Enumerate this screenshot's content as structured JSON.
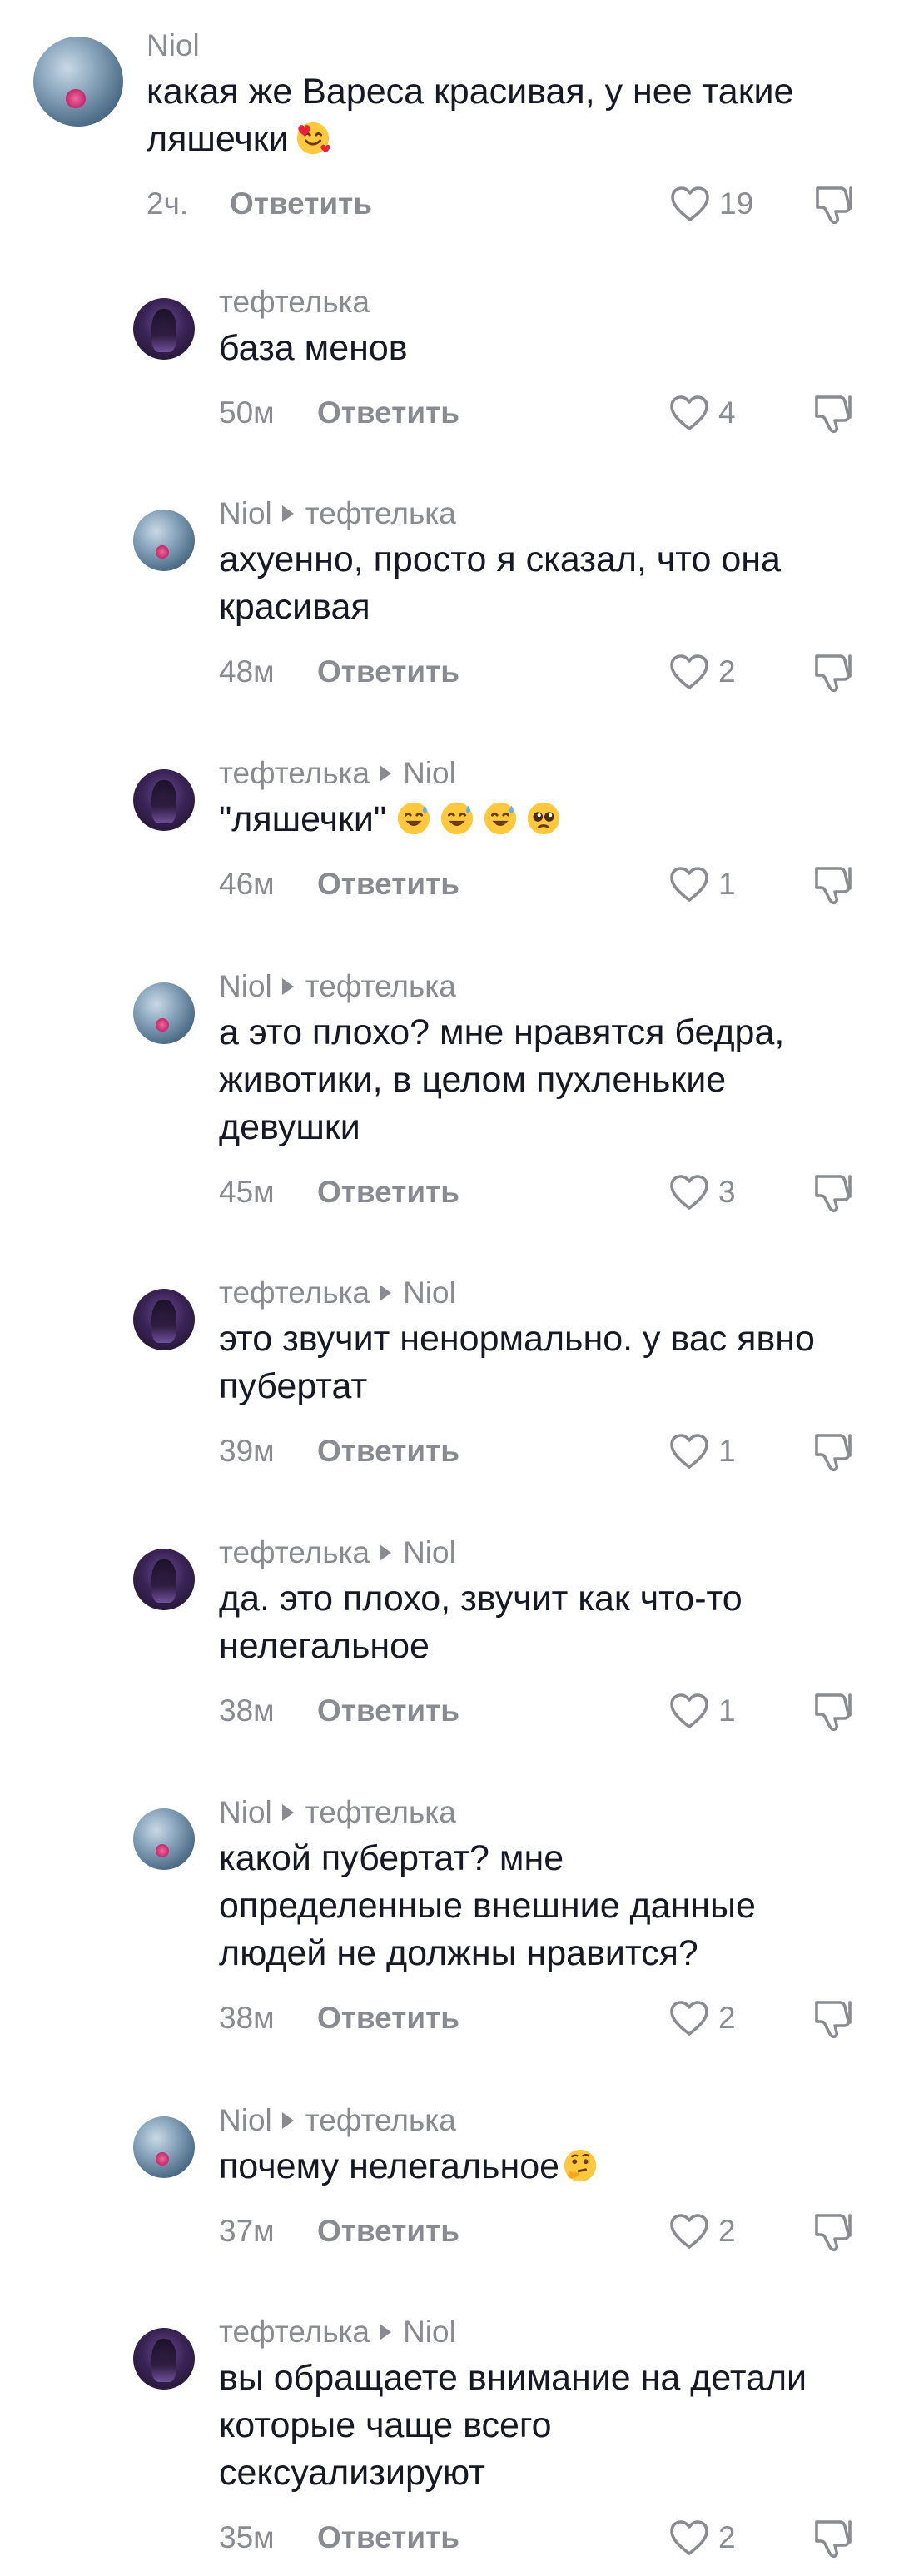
{
  "icons": {
    "like": "heart-outline-icon",
    "dislike": "thumbs-down-icon",
    "reply_arrow": "triangle-right-icon"
  },
  "colors": {
    "text": "#161823",
    "secondary": "#8a8b91",
    "background": "#ffffff"
  },
  "comments": [
    {
      "author": "Niol",
      "reply_to": "",
      "text": "какая же Вареса красивая, у нее такие",
      "text2": "ляшечки",
      "emoji": "🥰",
      "time": "2ч.",
      "reply_label": "Ответить",
      "likes": "19"
    },
    {
      "author": "тефтелька",
      "reply_to": "",
      "text": "база менов",
      "time": "50м",
      "reply_label": "Ответить",
      "likes": "4"
    },
    {
      "author": "Niol",
      "reply_to": "тефтелька",
      "text": "ахуенно, просто я сказал, что она\nкрасивая",
      "time": "48м",
      "reply_label": "Ответить",
      "likes": "2"
    },
    {
      "author": "тефтелька",
      "reply_to": "Niol",
      "text": "\"ляшечки\"",
      "emoji": "😅😅😅🥺",
      "time": "46м",
      "reply_label": "Ответить",
      "likes": "1"
    },
    {
      "author": "Niol",
      "reply_to": "тефтелька",
      "text": "а это плохо? мне нравятся бедра,\nживотики, в целом пухленькие\nдевушки",
      "time": "45м",
      "reply_label": "Ответить",
      "likes": "3"
    },
    {
      "author": "тефтелька",
      "reply_to": "Niol",
      "text": "это звучит ненормально. у вас явно\nпубертат",
      "time": "39м",
      "reply_label": "Ответить",
      "likes": "1"
    },
    {
      "author": "тефтелька",
      "reply_to": "Niol",
      "text": "да. это плохо, звучит как что-то\nнелегальное",
      "time": "38м",
      "reply_label": "Ответить",
      "likes": "1"
    },
    {
      "author": "Niol",
      "reply_to": "тефтелька",
      "text": "какой пубертат? мне\nопределенные внешние данные\nлюдей не должны нравится?",
      "time": "38м",
      "reply_label": "Ответить",
      "likes": "2"
    },
    {
      "author": "Niol",
      "reply_to": "тефтелька",
      "text": "почему нелегальное",
      "emoji": "🤔",
      "time": "37м",
      "reply_label": "Ответить",
      "likes": "2"
    },
    {
      "author": "тефтелька",
      "reply_to": "Niol",
      "text": "вы обращаете внимание на детали\nкоторые чаще всего\nсексуализируют",
      "time": "35м",
      "reply_label": "Ответить",
      "likes": "2"
    }
  ]
}
